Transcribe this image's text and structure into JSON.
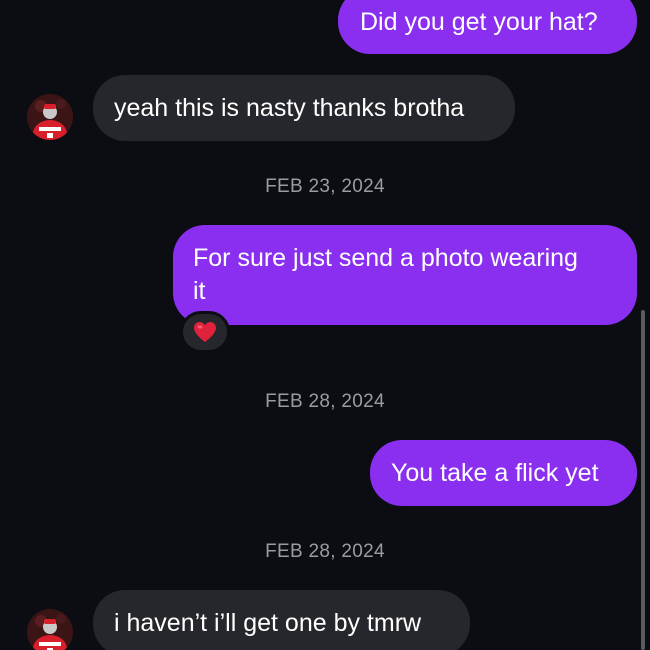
{
  "colors": {
    "background": "#0b0d12",
    "sent_bubble": "#8a2ff0",
    "received_bubble": "#26272c",
    "date_text": "#9a9ca3",
    "reaction_heart": "#e0223a"
  },
  "messages": [
    {
      "direction": "sent",
      "text": "Did you get your hat?"
    },
    {
      "direction": "received",
      "text": "yeah this is nasty thanks brotha",
      "avatar": "avatar-icon"
    },
    {
      "type": "date",
      "text": "FEB 23, 2024"
    },
    {
      "direction": "sent",
      "text": "For sure just send a photo wearing\nit",
      "reaction": "red-heart-icon"
    },
    {
      "type": "date",
      "text": "FEB 28, 2024"
    },
    {
      "direction": "sent",
      "text": "You take a flick yet"
    },
    {
      "type": "date",
      "text": "FEB 28, 2024"
    },
    {
      "direction": "received",
      "text": "i haven’t i’ll get one by tmrw",
      "avatar": "avatar-icon"
    }
  ]
}
